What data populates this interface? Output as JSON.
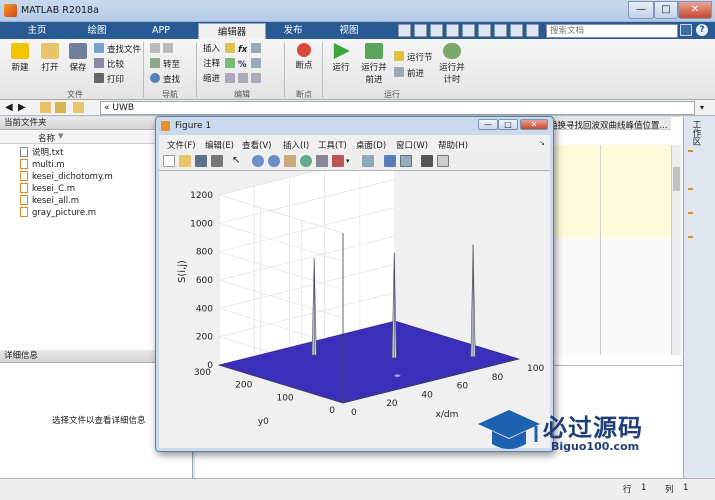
{
  "window": {
    "title": "MATLAB R2018a",
    "minimize": "—",
    "maximize": "□",
    "close": "✕"
  },
  "ribbon_tabs": [
    "主页",
    "绘图",
    "APP",
    "编辑器",
    "发布",
    "视图"
  ],
  "search": {
    "placeholder": "搜索文档"
  },
  "help_icon": "?",
  "ribbon": {
    "file": {
      "new": "新建",
      "open": "打开",
      "save": "保存",
      "find_files": "查找文件",
      "compare": "比较",
      "print": "打印",
      "group": "文件"
    },
    "navigate": {
      "goto": "转至",
      "find": "查找",
      "group": "导航"
    },
    "edit": {
      "insert": "插入",
      "comment": "注释",
      "indent": "缩进",
      "fx": "fx",
      "pct": "%",
      "group": "编辑"
    },
    "breakpoints": {
      "label": "断点",
      "group": "断点"
    },
    "run": {
      "run": "运行",
      "run_advance": "运行并前进",
      "run_section": "运行节",
      "advance": "前进",
      "run_time": "运行并计时",
      "group": "运行"
    }
  },
  "address": {
    "path": "«  UWB"
  },
  "current_folder": {
    "title": "当前文件夹",
    "column": "名称",
    "files": [
      "说明.txt",
      "multi.m",
      "kesei_dichotomy.m",
      "kesei_C.m",
      "kesei_all.m",
      "gray_picture.m"
    ]
  },
  "details": {
    "title": "详细信息",
    "message": "选择文件以查看详细信息"
  },
  "editor": {
    "tab_text": "趋换寻找回波双曲线峰值位置..."
  },
  "side_panel": {
    "label": "工作区"
  },
  "status": {
    "row_label": "行",
    "row": "1",
    "col_label": "列",
    "col": "1"
  },
  "figure": {
    "title": "Figure 1",
    "menus": [
      "文件(F)",
      "编辑(E)",
      "查看(V)",
      "插入(I)",
      "工具(T)",
      "桌面(D)",
      "窗口(W)",
      "帮助(H)"
    ]
  },
  "watermark": {
    "text_cn": "必过源码",
    "text_en": "Biguo100.com"
  },
  "chart_data": {
    "type": "surface",
    "zlabel": "S(i,j)",
    "ylabel": "y0",
    "xlabel": "x/dm",
    "z_ticks": [
      0,
      200,
      400,
      600,
      800,
      1000,
      1200
    ],
    "y_ticks": [
      0,
      100,
      200,
      300
    ],
    "x_ticks": [
      0,
      20,
      40,
      60,
      80,
      100
    ],
    "zlim": [
      0,
      1200
    ],
    "ylim": [
      0,
      300
    ],
    "xlim": [
      0,
      100
    ],
    "grid": true,
    "surface_color": "#3a2fb8",
    "peak_color": "#c8d2dc"
  }
}
